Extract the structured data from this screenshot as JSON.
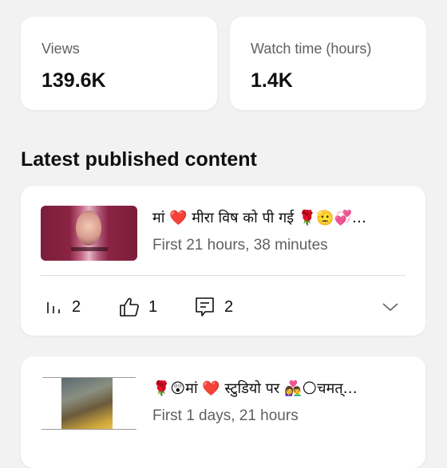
{
  "stats": {
    "views": {
      "label": "Views",
      "value": "139.6K"
    },
    "watch_time": {
      "label": "Watch time (hours)",
      "value": "1.4K"
    }
  },
  "section_title": "Latest published content",
  "content": [
    {
      "title": "मां ❤️ मीरा विष को पी गई 🌹🫡💞…",
      "subtitle": "First 21 hours, 38 minutes",
      "views": "2",
      "likes": "1",
      "comments": "2"
    },
    {
      "title": "🌹😲मां ❤️ स्टुडियो पर 👩‍❤️‍👨🌕चमत्…",
      "subtitle": "First 1 days, 21 hours"
    }
  ],
  "icons": {
    "views": "bar-chart-icon",
    "likes": "thumbs-up-icon",
    "comments": "comment-icon",
    "expand": "chevron-down-icon"
  },
  "colors": {
    "background": "#f2f2f2",
    "card": "#ffffff",
    "secondary_text": "#606060"
  }
}
